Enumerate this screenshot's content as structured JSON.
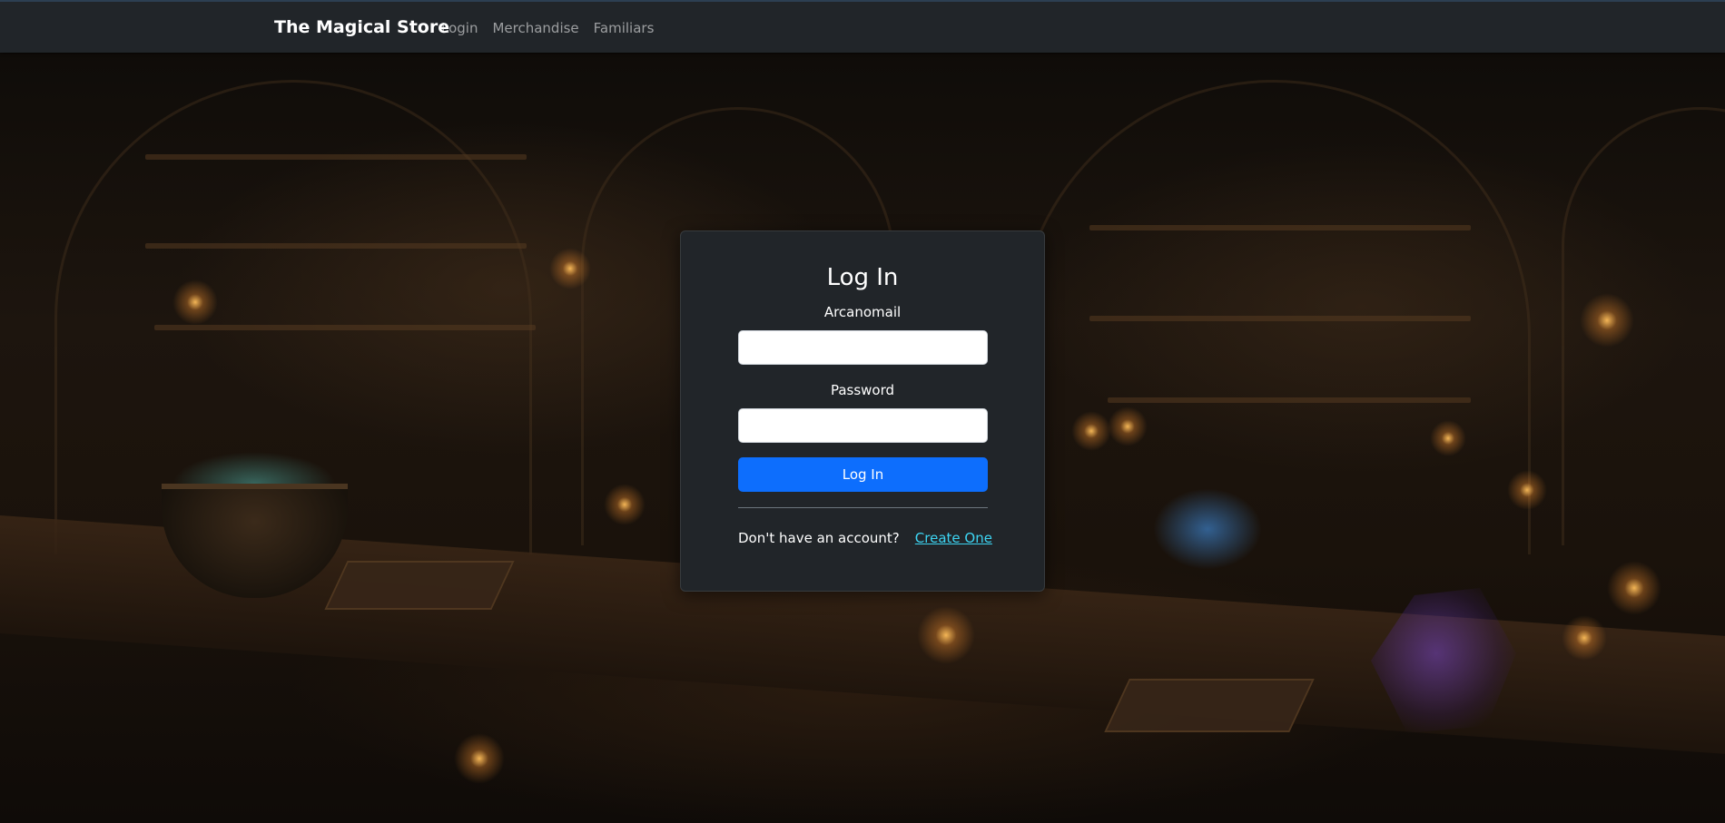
{
  "navbar": {
    "brand": "The Magical Store",
    "links": [
      {
        "label": "Login"
      },
      {
        "label": "Merchandise"
      },
      {
        "label": "Familiars"
      }
    ]
  },
  "login": {
    "title": "Log In",
    "email_label": "Arcanomail",
    "email_value": "",
    "password_label": "Password",
    "password_value": "",
    "submit_label": "Log In",
    "signup_prompt": "Don't have an account?",
    "signup_link": "Create One"
  },
  "theme": {
    "navbar_bg": "#212529",
    "card_bg": "#212529",
    "primary": "#0d6efd",
    "link": "#3dd5f3"
  }
}
